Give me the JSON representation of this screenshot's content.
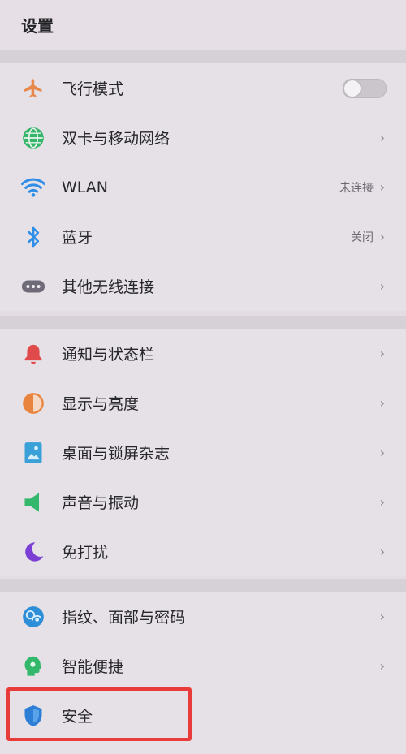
{
  "header": {
    "title": "设置"
  },
  "groups": [
    {
      "items": [
        {
          "label": "飞行模式",
          "icon": "airplane-icon",
          "control": "toggle",
          "toggle_on": false
        },
        {
          "label": "双卡与移动网络",
          "icon": "globe-icon",
          "chevron": "›"
        },
        {
          "label": "WLAN",
          "icon": "wifi-icon",
          "status": "未连接",
          "chevron": "›"
        },
        {
          "label": "蓝牙",
          "icon": "bluetooth-icon",
          "status": "关闭",
          "chevron": "›"
        },
        {
          "label": "其他无线连接",
          "icon": "more-connections-icon",
          "chevron": "›"
        }
      ]
    },
    {
      "items": [
        {
          "label": "通知与状态栏",
          "icon": "bell-icon",
          "chevron": "›"
        },
        {
          "label": "显示与亮度",
          "icon": "brightness-icon",
          "chevron": "›"
        },
        {
          "label": "桌面与锁屏杂志",
          "icon": "wallpaper-icon",
          "chevron": "›"
        },
        {
          "label": "声音与振动",
          "icon": "speaker-icon",
          "chevron": "›"
        },
        {
          "label": "免打扰",
          "icon": "moon-icon",
          "chevron": "›"
        }
      ]
    },
    {
      "items": [
        {
          "label": "指纹、面部与密码",
          "icon": "fingerprint-face-icon",
          "chevron": "›"
        },
        {
          "label": "智能便捷",
          "icon": "smart-assist-icon",
          "chevron": "›"
        },
        {
          "label": "安全",
          "icon": "shield-icon"
        }
      ]
    }
  ],
  "colors": {
    "airplane": "#e7894a",
    "globe": "#36b46a",
    "wifi": "#2f8ee8",
    "bluetooth": "#2f8ee8",
    "more": "#6e6a78",
    "bell": "#e04a4a",
    "brightness": "#e9843f",
    "wallpaper": "#3aa0d8",
    "speaker": "#33b86b",
    "moon": "#7b3fd6",
    "fingerprint": "#2e8fd8",
    "smart": "#33b86b",
    "shield": "#2d7fd6",
    "highlight": "#ea3b3b"
  }
}
